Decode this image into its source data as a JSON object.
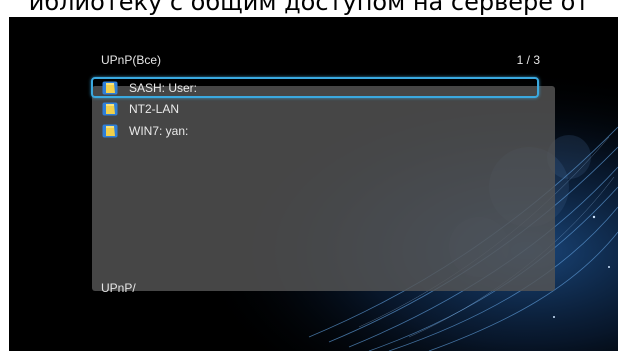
{
  "caption": "иблиотеку с общим доступом на сервере от",
  "header": {
    "title": "UPnP(Все)",
    "page_counter": "1 / 3"
  },
  "items": [
    {
      "label": "SASH: User:",
      "icon": "folder-icon",
      "selected": true
    },
    {
      "label": "NT2-LAN",
      "icon": "folder-icon",
      "selected": false
    },
    {
      "label": "WIN7: yan:",
      "icon": "folder-icon",
      "selected": false
    }
  ],
  "footer": {
    "path": "UPnP/"
  },
  "colors": {
    "selection": "#3aa9e0",
    "panel": "#555555",
    "background": "#000000"
  }
}
